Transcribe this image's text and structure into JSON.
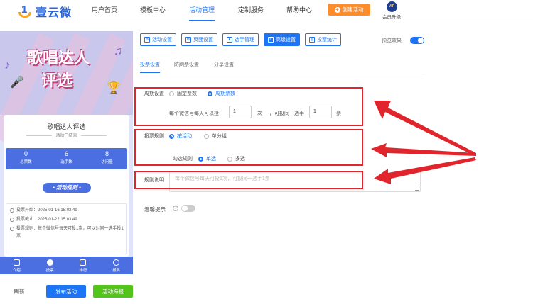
{
  "brand": {
    "name": "壹云微",
    "logo_digit": "1"
  },
  "nav": {
    "items": [
      "用户首页",
      "模板中心",
      "活动管理",
      "定制服务",
      "帮助中心"
    ],
    "create_label": "创建活动",
    "vip_badge": "VIP",
    "vip_label": "会员升级"
  },
  "preview": {
    "banner_line1": "歌唱达人",
    "banner_line2": "评选",
    "card_title": "歌唱达人评选",
    "card_subtitle": "活动已结束",
    "stats": [
      {
        "value": "0",
        "label": "总票数"
      },
      {
        "value": "6",
        "label": "选手数"
      },
      {
        "value": "8",
        "label": "访问量"
      }
    ],
    "rules_button": "• 活动规则 •",
    "rules": [
      "投票开始：2025-01-16 15:03:49",
      "投票截止：2025-01-22 15:03:49",
      "投票规则：每个微信号每天可投1次，可以对同一选手投1票"
    ],
    "bottom_nav": [
      "介绍",
      "投票",
      "排行",
      "报名"
    ]
  },
  "actions": {
    "refresh": "刷新",
    "publish": "发布活动",
    "poster": "活动海报"
  },
  "toolbar": {
    "items": [
      "活动设置",
      "页面设置",
      "选手管理",
      "高级设置",
      "投票统计"
    ],
    "preview_label": "预览效果",
    "preview_enabled": true
  },
  "subtabs": [
    "投票设置",
    "防刷票设置",
    "分享设置"
  ],
  "form": {
    "cycle_label": "周期设置",
    "cycle_options": [
      "固定票数",
      "周期票数"
    ],
    "limit_prefix": "每个微信号每天可以投",
    "limit_value": "1",
    "limit_unit": "次",
    "same_prefix": "，可投同一选手",
    "same_value": "1",
    "same_unit": "票",
    "rule_label": "投票规则",
    "rule_options": [
      "按活动",
      "单分组"
    ],
    "check_label": "勾选规则",
    "check_options": [
      "单选",
      "多选"
    ],
    "desc_label": "规则说明",
    "desc_placeholder": "每个微信号每天可投1次，可投同一选手1票",
    "tip_label": "温馨提示",
    "tip_help": "?",
    "tip_enabled": false
  },
  "colors": {
    "accent": "#1d74f5",
    "orange": "#ff8c2b",
    "green": "#52c41a",
    "highlight": "#e0262c"
  }
}
